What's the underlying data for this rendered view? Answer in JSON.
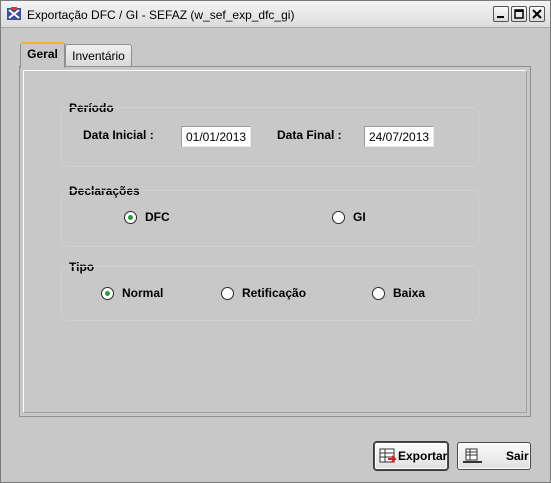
{
  "window": {
    "title": "Exportação DFC / GI - SEFAZ (w_sef_exp_dfc_gi)",
    "icon": "app-icon"
  },
  "tabs": [
    {
      "label": "Geral",
      "active": true
    },
    {
      "label": "Inventário",
      "active": false
    }
  ],
  "periodo": {
    "title": "Período",
    "start_label": "Data Inicial  :",
    "start_value": "01/01/2013",
    "end_label": "Data Final :",
    "end_value": "24/07/2013"
  },
  "declaracoes": {
    "title": "Declarações",
    "options": [
      {
        "label": "DFC",
        "selected": true
      },
      {
        "label": "GI",
        "selected": false
      }
    ]
  },
  "tipo": {
    "title": "Tipo",
    "options": [
      {
        "label": "Normal",
        "selected": true
      },
      {
        "label": "Retificação",
        "selected": false
      },
      {
        "label": "Baixa",
        "selected": false
      }
    ]
  },
  "buttons": {
    "export_label": "Exportar",
    "exit_label": "Sair"
  },
  "colors": {
    "window_bg": "#c8c8c8",
    "radio_selected": "#2b9a3c",
    "active_tab_accent": "#f0b040"
  }
}
